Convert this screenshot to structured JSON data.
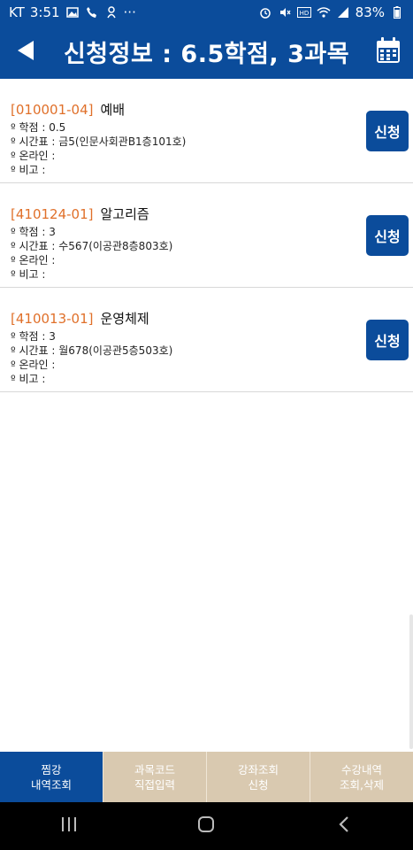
{
  "status_bar": {
    "carrier": "KT",
    "time": "3:51",
    "dots": "···",
    "battery": "83%",
    "icons": [
      "image-icon",
      "call-icon",
      "bixby-icon",
      "alarm-icon",
      "mute-icon",
      "hd-icon",
      "wifi-icon",
      "signal-icon",
      "battery-icon"
    ]
  },
  "header": {
    "title": "신청정보 : 6.5학점,  3과목",
    "back_icon": "back-arrow-icon",
    "calendar_icon": "calendar-icon"
  },
  "courses": [
    {
      "code": "[010001-04]",
      "name": "예배",
      "credit": "º 학점 : 0.5",
      "schedule": "º 시간표 : 금5(인문사회관B1층101호)",
      "online": "º 온라인 :",
      "note": "º 비고 :",
      "button": "신청"
    },
    {
      "code": "[410124-01]",
      "name": "알고리즘",
      "credit": "º 학점 : 3",
      "schedule": "º 시간표 : 수567(이공관8층803호)",
      "online": "º 온라인 :",
      "note": "º 비고 :",
      "button": "신청"
    },
    {
      "code": "[410013-01]",
      "name": "운영체제",
      "credit": "º 학점 : 3",
      "schedule": "º 시간표 : 월678(이공관5층503호)",
      "online": "º 온라인 :",
      "note": "º 비고 :",
      "button": "신청"
    }
  ],
  "tabs": [
    {
      "line1": "찜강",
      "line2": "내역조회",
      "active": true
    },
    {
      "line1": "과목코드",
      "line2": "직접입력",
      "active": false
    },
    {
      "line1": "강좌조회",
      "line2": "신청",
      "active": false
    },
    {
      "line1": "수강내역",
      "line2": "조회,삭제",
      "active": false
    }
  ],
  "nav_bar": {
    "icons": [
      "recent-apps-icon",
      "home-icon",
      "back-icon"
    ]
  },
  "colors": {
    "brand_blue": "#0b4c9b",
    "course_code_orange": "#e0702a",
    "tab_beige": "#d9c9b0"
  }
}
